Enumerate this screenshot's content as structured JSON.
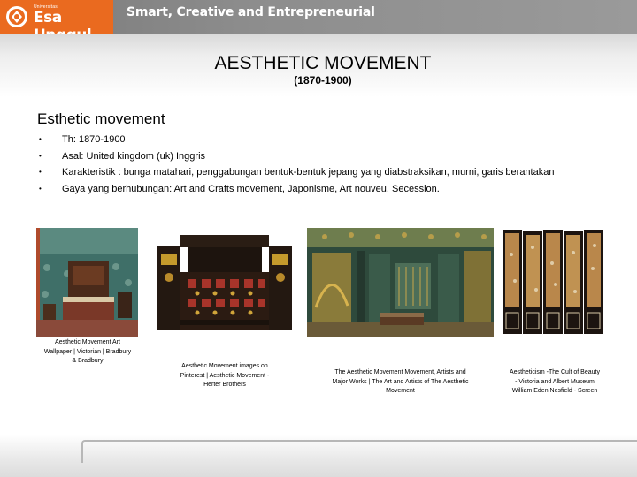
{
  "header": {
    "logo_small_text": "Universitas",
    "logo_name": "Esa Unggul",
    "tagline": "Smart, Creative and Entrepreneurial"
  },
  "slide": {
    "title": "AESTHETIC MOVEMENT",
    "subtitle": "(1870-1900)",
    "section_heading": "Esthetic movement",
    "bullets": [
      "Th: 1870-1900",
      "Asal: United kingdom (uk) Inggris",
      "Karakteristik : bunga matahari, penggabungan bentuk-bentuk jepang yang diabstraksikan, murni, garis berantakan",
      "Gaya yang berhubungan: Art and Crafts movement, Japonisme, Art nouveu, Secession."
    ],
    "bullet_symbol": "•"
  },
  "gallery": [
    {
      "icon": "bedroom-photo",
      "caption": "Aesthetic Movement Art Wallpaper | Victorian | Bradbury & Bradbury"
    },
    {
      "icon": "cabinet-bed-photo",
      "caption": "Aesthetic Movement images on Pinterest | Aesthetic Movement - Herter Brothers"
    },
    {
      "icon": "peacock-room-photo",
      "caption": "The Aesthetic Movement Movement, Artists and Major Works | The Art and Artists of The Aesthetic Movement"
    },
    {
      "icon": "folding-screen-photo",
      "caption": "Aestheticism -The Cult of Beauty - Victoria and Albert Museum William Eden Nesfield - Screen"
    }
  ],
  "colors": {
    "brand_orange": "#ea6a1f",
    "banner_gray": "#8d8d8d"
  }
}
